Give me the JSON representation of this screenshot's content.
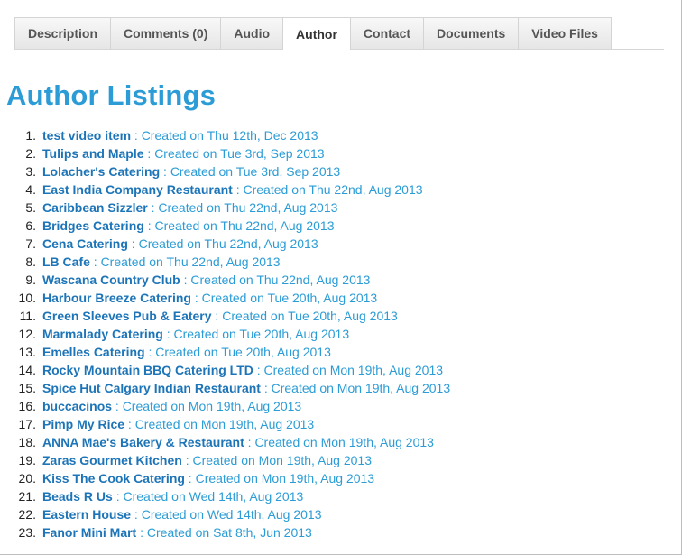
{
  "tabs": [
    {
      "label": "Description",
      "name": "tab-description",
      "active": false
    },
    {
      "label": "Comments (0)",
      "name": "tab-comments",
      "active": false
    },
    {
      "label": "Audio",
      "name": "tab-audio",
      "active": false
    },
    {
      "label": "Author",
      "name": "tab-author",
      "active": true
    },
    {
      "label": "Contact",
      "name": "tab-contact",
      "active": false
    },
    {
      "label": "Documents",
      "name": "tab-documents",
      "active": false
    },
    {
      "label": "Video Files",
      "name": "tab-video-files",
      "active": false
    }
  ],
  "page_title": "Author Listings",
  "created_prefix": " : Created on ",
  "listings": [
    {
      "num": "1.",
      "title": "test video item",
      "date": "Thu 12th, Dec 2013"
    },
    {
      "num": "2.",
      "title": "Tulips and Maple",
      "date": "Tue 3rd, Sep 2013"
    },
    {
      "num": "3.",
      "title": "Lolacher's Catering",
      "date": "Tue 3rd, Sep 2013"
    },
    {
      "num": "4.",
      "title": "East India Company Restaurant",
      "date": "Thu 22nd, Aug 2013"
    },
    {
      "num": "5.",
      "title": "Caribbean Sizzler",
      "date": "Thu 22nd, Aug 2013"
    },
    {
      "num": "6.",
      "title": "Bridges Catering",
      "date": "Thu 22nd, Aug 2013"
    },
    {
      "num": "7.",
      "title": "Cena Catering",
      "date": "Thu 22nd, Aug 2013"
    },
    {
      "num": "8.",
      "title": "LB Cafe",
      "date": "Thu 22nd, Aug 2013"
    },
    {
      "num": "9.",
      "title": "Wascana Country Club",
      "date": "Thu 22nd, Aug 2013"
    },
    {
      "num": "10.",
      "title": "Harbour Breeze Catering",
      "date": "Tue 20th, Aug 2013"
    },
    {
      "num": "11.",
      "title": "Green Sleeves Pub & Eatery",
      "date": "Tue 20th, Aug 2013"
    },
    {
      "num": "12.",
      "title": "Marmalady Catering",
      "date": "Tue 20th, Aug 2013"
    },
    {
      "num": "13.",
      "title": "Emelles Catering",
      "date": "Tue 20th, Aug 2013"
    },
    {
      "num": "14.",
      "title": "Rocky Mountain BBQ Catering LTD",
      "date": "Mon 19th, Aug 2013"
    },
    {
      "num": "15.",
      "title": "Spice Hut Calgary Indian Restaurant",
      "date": "Mon 19th, Aug 2013"
    },
    {
      "num": "16.",
      "title": "buccacinos",
      "date": "Mon 19th, Aug 2013"
    },
    {
      "num": "17.",
      "title": "Pimp My Rice",
      "date": "Mon 19th, Aug 2013"
    },
    {
      "num": "18.",
      "title": "ANNA Mae's Bakery & Restaurant",
      "date": "Mon 19th, Aug 2013"
    },
    {
      "num": "19.",
      "title": "Zaras Gourmet Kitchen",
      "date": "Mon 19th, Aug 2013"
    },
    {
      "num": "20.",
      "title": "Kiss The Cook Catering",
      "date": "Mon 19th, Aug 2013"
    },
    {
      "num": "21.",
      "title": "Beads R Us",
      "date": "Wed 14th, Aug 2013"
    },
    {
      "num": "22.",
      "title": "Eastern House",
      "date": "Wed 14th, Aug 2013"
    },
    {
      "num": "23.",
      "title": "Fanor Mini Mart",
      "date": "Sat 8th, Jun 2013"
    }
  ],
  "colors": {
    "title": "#2b9cd6",
    "link": "#1d75b8",
    "meta": "#2b9cd6"
  }
}
